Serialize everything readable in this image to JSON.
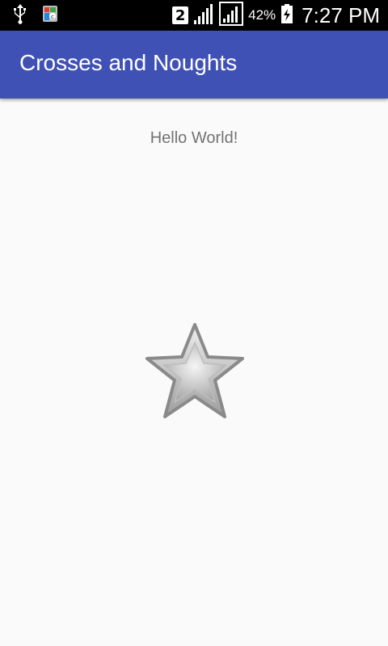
{
  "status_bar": {
    "sim_slot": "2",
    "battery_percent": "42%",
    "time": "7:27 PM",
    "icons": [
      "usb-icon",
      "app-notification-icon",
      "signal-icon",
      "signal-icon",
      "battery-icon"
    ]
  },
  "app_bar": {
    "title": "Crosses and Noughts",
    "color": "#3f51b5"
  },
  "content": {
    "greeting": "Hello World!",
    "star_icon": "star-icon"
  }
}
